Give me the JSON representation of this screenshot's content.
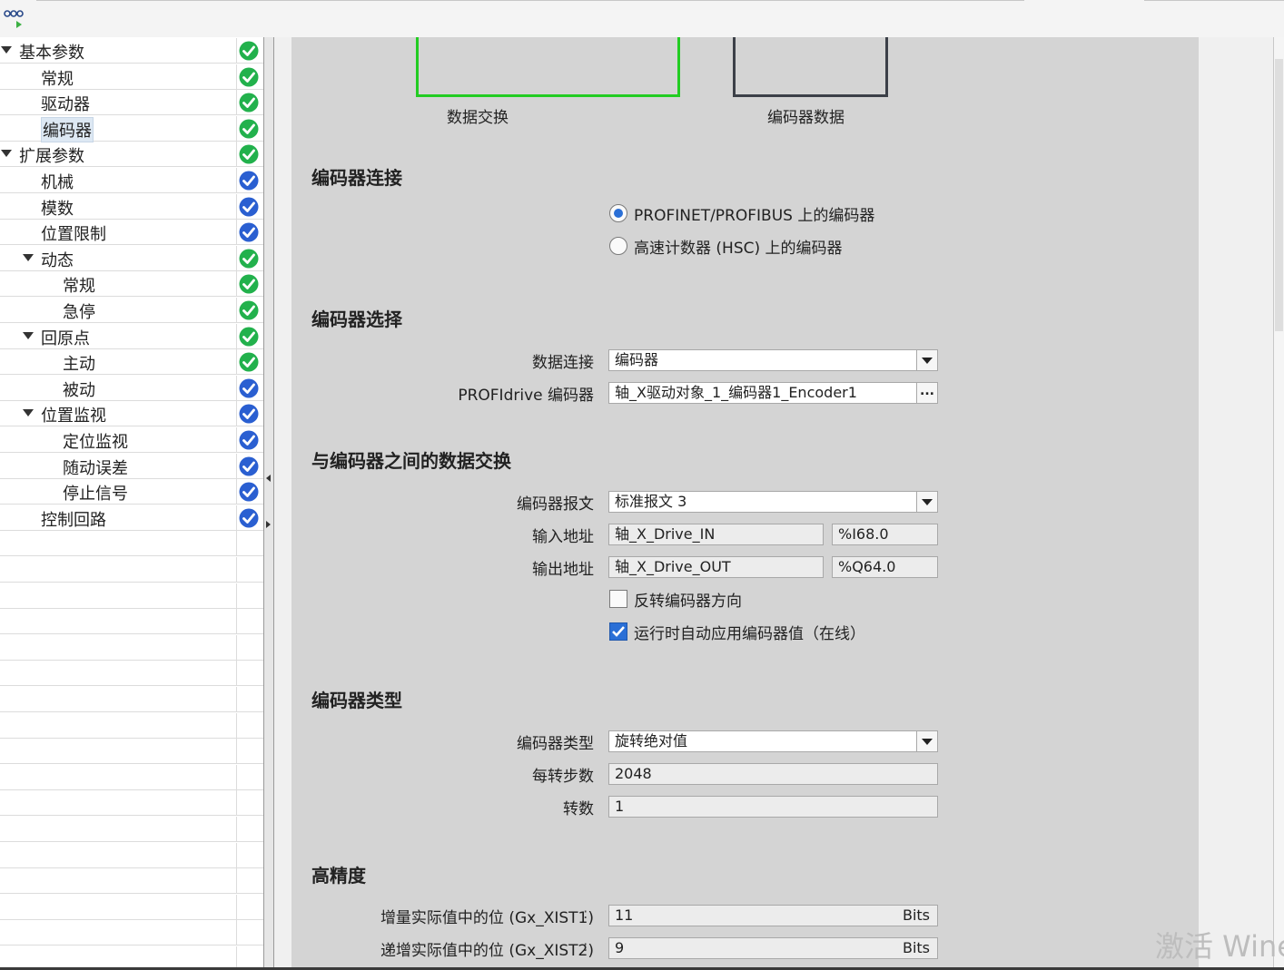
{
  "colors": {
    "ok_green": "#22b14c",
    "blue": "#2a5fd1",
    "accent_green": "#22cc22",
    "panel": "#d4d4d4"
  },
  "tree": {
    "items": [
      {
        "label": "基本参数",
        "level": 0,
        "expander": true,
        "status": "green-check-icon"
      },
      {
        "label": "常规",
        "level": 1,
        "expander": false,
        "status": "green-check-icon"
      },
      {
        "label": "驱动器",
        "level": 1,
        "expander": false,
        "status": "green-check-icon"
      },
      {
        "label": "编码器",
        "level": 1,
        "expander": false,
        "status": "green-check-icon",
        "selected": true
      },
      {
        "label": "扩展参数",
        "level": 0,
        "expander": true,
        "status": "green-check-icon"
      },
      {
        "label": "机械",
        "level": 1,
        "expander": false,
        "status": "blue-check-icon"
      },
      {
        "label": "模数",
        "level": 1,
        "expander": false,
        "status": "blue-check-icon"
      },
      {
        "label": "位置限制",
        "level": 1,
        "expander": false,
        "status": "blue-check-icon"
      },
      {
        "label": "动态",
        "level": 1,
        "expander": true,
        "status": "green-check-icon"
      },
      {
        "label": "常规",
        "level": 2,
        "expander": false,
        "status": "green-check-icon"
      },
      {
        "label": "急停",
        "level": 2,
        "expander": false,
        "status": "green-check-icon"
      },
      {
        "label": "回原点",
        "level": 1,
        "expander": true,
        "status": "green-check-icon"
      },
      {
        "label": "主动",
        "level": 2,
        "expander": false,
        "status": "green-check-icon"
      },
      {
        "label": "被动",
        "level": 2,
        "expander": false,
        "status": "blue-check-icon"
      },
      {
        "label": "位置监视",
        "level": 1,
        "expander": true,
        "status": "blue-check-icon"
      },
      {
        "label": "定位监视",
        "level": 2,
        "expander": false,
        "status": "blue-check-icon"
      },
      {
        "label": "随动误差",
        "level": 2,
        "expander": false,
        "status": "blue-check-icon"
      },
      {
        "label": "停止信号",
        "level": 2,
        "expander": false,
        "status": "blue-check-icon"
      },
      {
        "label": "控制回路",
        "level": 1,
        "expander": false,
        "status": "blue-check-icon"
      }
    ]
  },
  "diagram": {
    "left_caption": "数据交换",
    "right_caption": "编码器数据"
  },
  "sections": {
    "connection": {
      "title": "编码器连接",
      "options": [
        "PROFINET/PROFIBUS 上的编码器",
        "高速计数器 (HSC) 上的编码器"
      ],
      "selected_index": 0
    },
    "selection": {
      "title": "编码器选择",
      "data_connection_label": "数据连接",
      "data_connection_value": "编码器",
      "profidrive_label": "PROFIdrive 编码器",
      "profidrive_value": "轴_X驱动对象_1_编码器1_Encoder1",
      "browse_label": "..."
    },
    "exchange": {
      "title": "与编码器之间的数据交换",
      "telegram_label": "编码器报文",
      "telegram_value": "标准报文 3",
      "input_label": "输入地址",
      "input_name": "轴_X_Drive_IN",
      "input_addr": "%I68.0",
      "output_label": "输出地址",
      "output_name": "轴_X_Drive_OUT",
      "output_addr": "%Q64.0",
      "invert_label": "反转编码器方向",
      "invert_checked": false,
      "auto_apply_label": "运行时自动应用编码器值（在线）",
      "auto_apply_checked": true
    },
    "type": {
      "title": "编码器类型",
      "type_label": "编码器类型",
      "type_value": "旋转绝对值",
      "steps_label": "每转步数",
      "steps_value": "2048",
      "revs_label": "转数",
      "revs_value": "1"
    },
    "precision": {
      "title": "高精度",
      "inc_label": "增量实际值中的位 (Gx_XIST1)",
      "inc_value": "11",
      "inc_unit": "Bits",
      "abs_label": "递增实际值中的位 (Gx_XIST2)",
      "abs_value": "9",
      "abs_unit": "Bits"
    }
  },
  "colon": ":",
  "watermark": "激活 Wine"
}
